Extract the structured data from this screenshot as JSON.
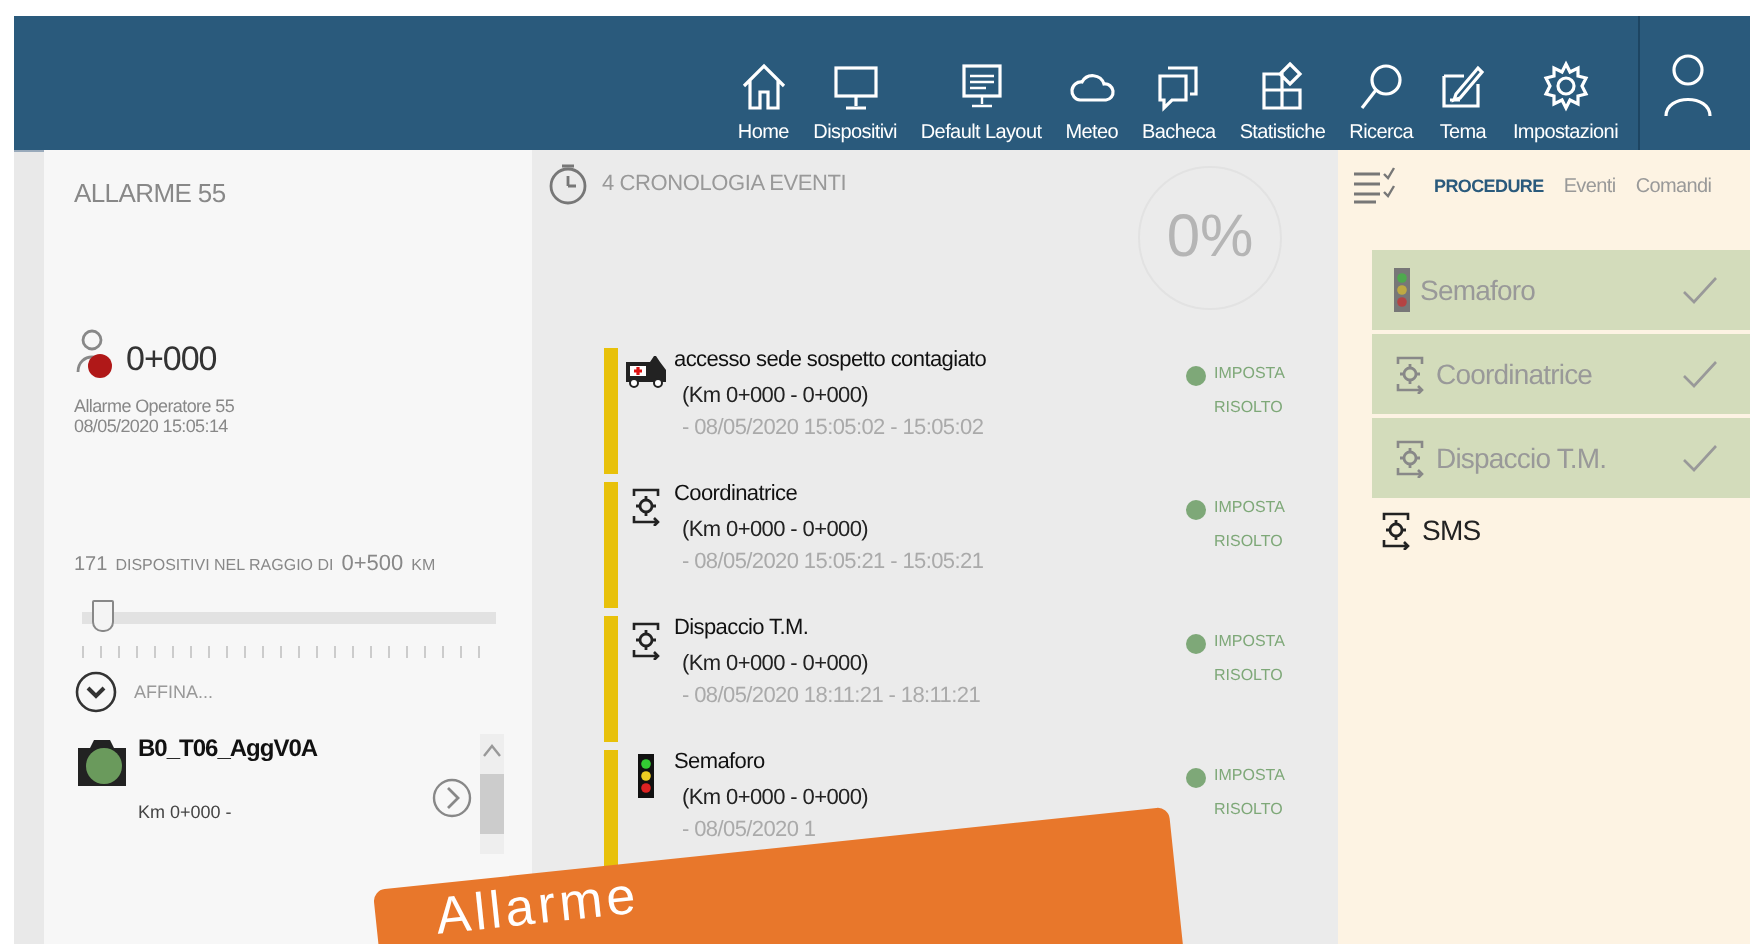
{
  "nav": [
    {
      "label": "Home",
      "kind": "home"
    },
    {
      "label": "Dispositivi",
      "kind": "monitor"
    },
    {
      "label": "Default Layout",
      "kind": "layout"
    },
    {
      "label": "Meteo",
      "kind": "cloud"
    },
    {
      "label": "Bacheca",
      "kind": "board"
    },
    {
      "label": "Statistiche",
      "kind": "stats"
    },
    {
      "label": "Ricerca",
      "kind": "search"
    },
    {
      "label": "Tema",
      "kind": "theme"
    },
    {
      "label": "Impostazioni",
      "kind": "settings"
    }
  ],
  "alarm": {
    "title": "ALLARME 55",
    "location": "0+000",
    "operator": "Allarme Operatore 55",
    "datetime": "08/05/2020 15:05:14",
    "radius": {
      "count": "171",
      "caption": "DISPOSITIVI NEL RAGGIO DI",
      "value": "0+500",
      "unit": "KM",
      "level": 0.05
    },
    "refine": {
      "label": "AFFINA...",
      "expanded": false
    },
    "devices": [
      {
        "name": "B0_T06_AggV0A",
        "detail": "Km 0+000 -",
        "color": "#6a9a5c"
      }
    ]
  },
  "events": {
    "title": "4 CRONOLOGIA EVENTI",
    "progress": "0%",
    "items": [
      {
        "kind": "ambulance",
        "title": "accesso sede sospetto contagiato",
        "km": "(Km 0+000 - 0+000)",
        "time": "- 08/05/2020 15:05:02 - 15:05:02",
        "actions": [
          "IMPOSTA",
          "RISOLTO"
        ]
      },
      {
        "kind": "gear",
        "title": "Coordinatrice",
        "km": "(Km 0+000 - 0+000)",
        "time": "- 08/05/2020 15:05:21 - 15:05:21",
        "actions": [
          "IMPOSTA",
          "RISOLTO"
        ]
      },
      {
        "kind": "gear",
        "title": "Dispaccio T.M.",
        "km": "(Km 0+000 - 0+000)",
        "time": "- 08/05/2020 18:11:21 - 18:11:21",
        "actions": [
          "IMPOSTA",
          "RISOLTO"
        ]
      },
      {
        "kind": "semaphore",
        "title": "Semaforo",
        "km": "(Km 0+000 - 0+000)",
        "time": "- 08/05/2020 1",
        "actions": [
          "IMPOSTA",
          "RISOLTO"
        ]
      }
    ]
  },
  "procedures": {
    "tabs": [
      {
        "label": "PROCEDURE",
        "selected": true
      },
      {
        "label": "Eventi",
        "selected": false
      },
      {
        "label": "Comandi",
        "selected": false
      }
    ],
    "items": [
      {
        "kind": "semaphore",
        "label": "Semaforo",
        "done": true
      },
      {
        "kind": "gear",
        "label": "Coordinatrice",
        "done": true
      },
      {
        "kind": "gear",
        "label": "Dispaccio T.M.",
        "done": true
      },
      {
        "kind": "gear",
        "label": "SMS",
        "done": false
      }
    ]
  },
  "banner": {
    "text": "Allarme"
  }
}
